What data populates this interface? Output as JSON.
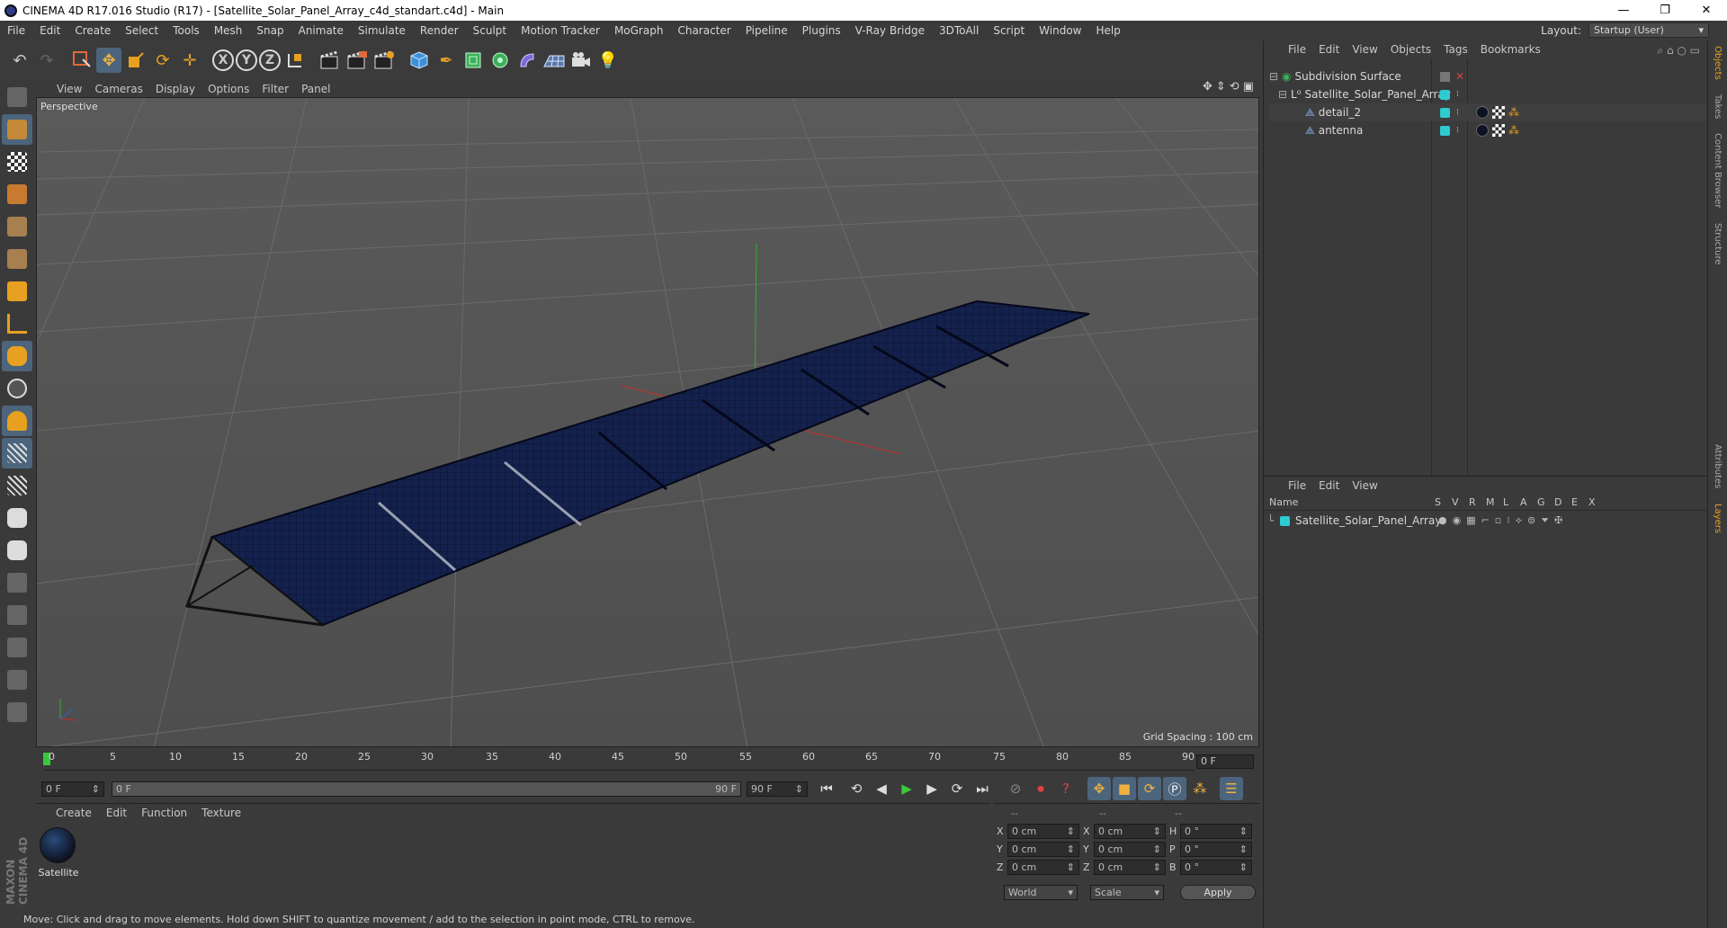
{
  "window": {
    "title": "CINEMA 4D R17.016 Studio (R17) - [Satellite_Solar_Panel_Array_c4d_standart.c4d] - Main",
    "minimize": "—",
    "maximize": "❐",
    "close": "✕"
  },
  "menu": [
    "File",
    "Edit",
    "Create",
    "Select",
    "Tools",
    "Mesh",
    "Snap",
    "Animate",
    "Simulate",
    "Render",
    "Sculpt",
    "Motion Tracker",
    "MoGraph",
    "Character",
    "Pipeline",
    "Plugins",
    "V-Ray Bridge",
    "3DToAll",
    "Script",
    "Window",
    "Help"
  ],
  "layout": {
    "label": "Layout:",
    "value": "Startup (User)"
  },
  "toolbar_axes": [
    "X",
    "Y",
    "Z"
  ],
  "viewport_menu": [
    "View",
    "Cameras",
    "Display",
    "Options",
    "Filter",
    "Panel"
  ],
  "viewport": {
    "label": "Perspective",
    "grid_spacing": "Grid Spacing : 100 cm"
  },
  "timeline": {
    "ticks": [
      "0",
      "5",
      "10",
      "15",
      "20",
      "25",
      "30",
      "35",
      "40",
      "45",
      "50",
      "55",
      "60",
      "65",
      "70",
      "75",
      "80",
      "85",
      "90"
    ],
    "current": "0 F"
  },
  "transport": {
    "start": "0 F",
    "range_start": "0 F",
    "range_end": "90 F",
    "end": "90 F"
  },
  "material_menu": [
    "Create",
    "Edit",
    "Function",
    "Texture"
  ],
  "material": {
    "name": "Satellite"
  },
  "coords": {
    "headers": [
      "--",
      "--",
      "--"
    ],
    "rows": [
      {
        "a": "X",
        "av": "0 cm",
        "b": "X",
        "bv": "0 cm",
        "c": "H",
        "cv": "0 °"
      },
      {
        "a": "Y",
        "av": "0 cm",
        "b": "Y",
        "bv": "0 cm",
        "c": "P",
        "cv": "0 °"
      },
      {
        "a": "Z",
        "av": "0 cm",
        "b": "Z",
        "bv": "0 cm",
        "c": "B",
        "cv": "0 °"
      }
    ],
    "world": "World",
    "scale": "Scale",
    "apply": "Apply"
  },
  "status": "Move: Click and drag to move elements. Hold down SHIFT to quantize movement / add to the selection in point mode, CTRL to remove.",
  "maxon": "MAXON CINEMA 4D",
  "objects_menu": [
    "File",
    "Edit",
    "View",
    "Objects",
    "Tags",
    "Bookmarks"
  ],
  "objects": [
    {
      "name": "Subdivision Surface"
    },
    {
      "name": "Satellite_Solar_Panel_Array"
    },
    {
      "name": "detail_2"
    },
    {
      "name": "antenna"
    }
  ],
  "layers_menu": [
    "File",
    "Edit",
    "View"
  ],
  "layers_cols": [
    "Name",
    "S",
    "V",
    "R",
    "M",
    "L",
    "A",
    "G",
    "D",
    "E",
    "X"
  ],
  "layers": [
    {
      "name": "Satellite_Solar_Panel_Array"
    }
  ],
  "side_tabs": [
    "Objects",
    "Takes",
    "Content Browser",
    "Structure",
    "Attributes",
    "Layers"
  ],
  "colors": {
    "accent_blue": "#4c657d",
    "layer_cyan": "#2ecbd0",
    "panel": "#0f1a3a"
  }
}
